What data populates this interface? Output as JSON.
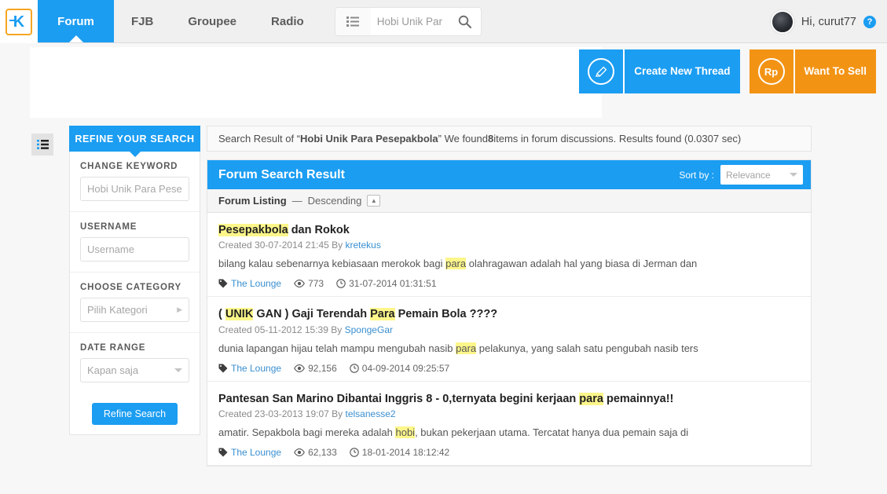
{
  "nav": {
    "logo": "logo-kaskus",
    "tabs": [
      {
        "label": "Forum",
        "active": true
      },
      {
        "label": "FJB",
        "active": false
      },
      {
        "label": "Groupee",
        "active": false
      },
      {
        "label": "Radio",
        "active": false
      }
    ],
    "search": {
      "value": "Hobi Unik Par",
      "placeholder": "Hobi Unik Par",
      "list_icon": "list-icon",
      "search_icon": "search-icon"
    },
    "user": {
      "greeting": "Hi, curut77",
      "help_icon": "?",
      "avatar": "user-avatar"
    }
  },
  "actions": [
    {
      "id": "create-new-thread",
      "icon": "pencil-icon",
      "icon_text": "✎",
      "label": "Create New Thread",
      "color": "#1b9df2"
    },
    {
      "id": "want-to-sell",
      "icon": "rupiah-icon",
      "icon_text": "Rp",
      "label": "Want To Sell",
      "color": "#f39314"
    }
  ],
  "sidebar": {
    "tab_label": "REFINE YOUR SEARCH",
    "groups": [
      {
        "label": "CHANGE KEYWORD",
        "type": "input",
        "value": "",
        "placeholder": "Hobi Unik Para Pese"
      },
      {
        "label": "USERNAME",
        "type": "input",
        "value": "",
        "placeholder": "Username"
      },
      {
        "label": "CHOOSE CATEGORY",
        "type": "select-right",
        "value": "Pilih Kategori"
      },
      {
        "label": "DATE RANGE",
        "type": "select-down",
        "value": "Kapan saja"
      }
    ],
    "refine_button": "Refine Search"
  },
  "summary": {
    "prefix": "Search Result of “",
    "query": "Hobi Unik Para Pesepakbola",
    "middle": "” We found ",
    "count": "8",
    "suffix": " items in forum discussions. Results found (0.0307 sec)"
  },
  "results_panel": {
    "title": "Forum Search Result",
    "sort_by_label": "Sort by :",
    "sort_by_value": "Relevance",
    "listing_label": "Forum Listing",
    "listing_dash": "—",
    "listing_order": "Descending",
    "sort_toggle_icon": "chevron-up-icon"
  },
  "results": [
    {
      "title_parts": [
        {
          "text": "Pesepakbola",
          "hl": true
        },
        {
          "text": " dan Rokok",
          "hl": false
        }
      ],
      "created_label": "Created",
      "created_date": "30-07-2014 21:45",
      "by_label": "By",
      "author": "kretekus",
      "snippet_parts": [
        {
          "text": "bilang kalau sebenarnya kebiasaan merokok bagi ",
          "hl": false
        },
        {
          "text": "para",
          "hl": true
        },
        {
          "text": " olahragawan adalah hal yang biasa di Jerman dan",
          "hl": false
        }
      ],
      "category": "The Lounge",
      "views": "773",
      "date": "31-07-2014 01:31:51"
    },
    {
      "title_parts": [
        {
          "text": "( ",
          "hl": false
        },
        {
          "text": "UNIK",
          "hl": true
        },
        {
          "text": " GAN ) Gaji Terendah ",
          "hl": false
        },
        {
          "text": "Para",
          "hl": true
        },
        {
          "text": " Pemain Bola ????",
          "hl": false
        }
      ],
      "created_label": "Created",
      "created_date": "05-11-2012 15:39",
      "by_label": "By",
      "author": "SpongeGar",
      "snippet_parts": [
        {
          "text": "dunia lapangan hijau telah mampu mengubah nasib ",
          "hl": false
        },
        {
          "text": "para",
          "hl": true
        },
        {
          "text": " pelakunya, yang salah satu pengubah nasib ters",
          "hl": false
        }
      ],
      "category": "The Lounge",
      "views": "92,156",
      "date": "04-09-2014 09:25:57"
    },
    {
      "title_parts": [
        {
          "text": "Pantesan San Marino Dibantai Inggris 8 - 0,ternyata begini kerjaan ",
          "hl": false
        },
        {
          "text": "para",
          "hl": true
        },
        {
          "text": " pemainnya!!",
          "hl": false
        }
      ],
      "created_label": "Created",
      "created_date": "23-03-2013 19:07",
      "by_label": "By",
      "author": "telsanesse2",
      "snippet_parts": [
        {
          "text": "amatir. Sepakbola bagi mereka adalah ",
          "hl": false
        },
        {
          "text": "hobi",
          "hl": true
        },
        {
          "text": ", bukan pekerjaan utama. Tercatat hanya dua pemain saja di",
          "hl": false
        }
      ],
      "category": "The Lounge",
      "views": "62,133",
      "date": "18-01-2014 18:12:42"
    }
  ],
  "icons": {
    "list_toggle": "list-icon",
    "tag": "tag-icon",
    "eye": "eye-icon",
    "clock": "clock-icon"
  }
}
